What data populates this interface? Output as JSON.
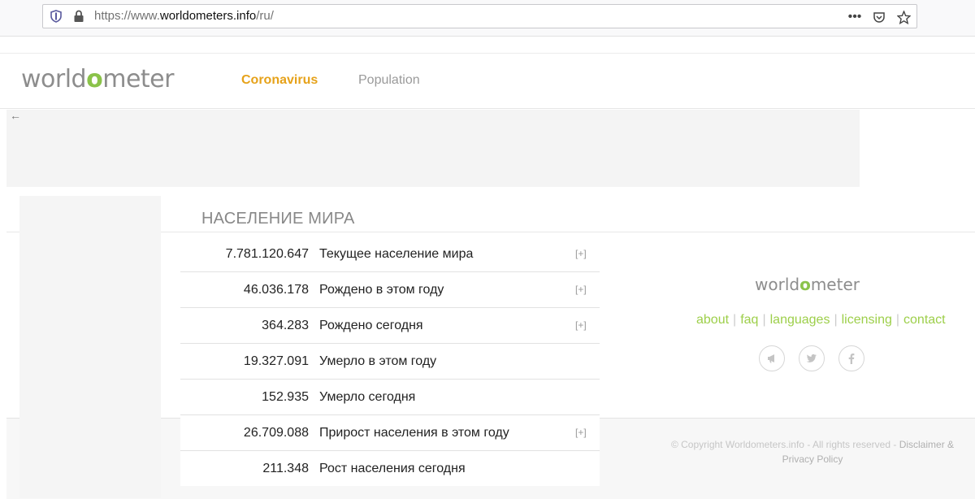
{
  "browser": {
    "url_prefix": "https://www.",
    "url_host": "worldometers.info",
    "url_path": "/ru/",
    "icons": [
      "shield-icon",
      "lock-icon",
      "more-icon",
      "pocket-icon",
      "star-icon"
    ]
  },
  "header": {
    "logo_prefix": "world",
    "logo_o": "o",
    "logo_suffix": "meter",
    "nav": {
      "coronavirus": "Coronavirus",
      "population": "Population"
    }
  },
  "colors": {
    "accent_orange": "#e6a21a",
    "brand_green": "#8bc34a",
    "link_green": "#9dcf4a"
  },
  "section": {
    "title": "НАСЕЛЕНИЕ МИРА"
  },
  "counters": [
    {
      "value": "7.781.120.647",
      "label": "Текущее население мира",
      "expand": "[+]"
    },
    {
      "value": "46.036.178",
      "label": "Рождено в этом году",
      "expand": "[+]"
    },
    {
      "value": "364.283",
      "label": "Рождено сегодня",
      "expand": "[+]"
    },
    {
      "value": "19.327.091",
      "label": "Умерло в этом году",
      "expand": ""
    },
    {
      "value": "152.935",
      "label": "Умерло сегодня",
      "expand": ""
    },
    {
      "value": "26.709.088",
      "label": "Прирост населения в этом году",
      "expand": "[+]"
    },
    {
      "value": "211.348",
      "label": "Рост населения сегодня",
      "expand": ""
    }
  ],
  "footer": {
    "links": {
      "about": "about",
      "faq": "faq",
      "languages": "languages",
      "licensing": "licensing",
      "contact": "contact"
    },
    "separator": "|",
    "copyright": "© Copyright Worldometers.info - All rights reserved - ",
    "disclaimer": "Disclaimer & Privacy Policy",
    "social_icons": [
      "megaphone-icon",
      "twitter-icon",
      "facebook-icon"
    ]
  }
}
